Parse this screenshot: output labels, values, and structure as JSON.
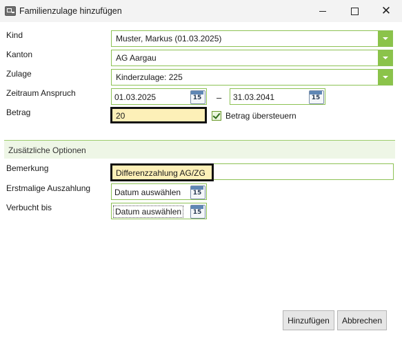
{
  "window": {
    "title": "Familienzulage hinzufügen"
  },
  "form": {
    "kind": {
      "label": "Kind",
      "value": "Muster, Markus (01.03.2025)"
    },
    "kanton": {
      "label": "Kanton",
      "value": "AG Aargau"
    },
    "zulage": {
      "label": "Zulage",
      "value": "Kinderzulage:  225"
    },
    "zeitraum": {
      "label": "Zeitraum Anspruch",
      "from": "01.03.2025",
      "separator": "–",
      "to": "31.03.2041"
    },
    "betrag": {
      "label": "Betrag",
      "value": "20",
      "override_label": "Betrag übersteuern",
      "override_checked": true
    }
  },
  "optionen": {
    "header": "Zusätzliche Optionen",
    "bemerkung": {
      "label": "Bemerkung",
      "value": "Differenzzahlung AG/ZG"
    },
    "erstmalige": {
      "label": "Erstmalige Auszahlung",
      "placeholder": "Datum auswählen"
    },
    "verbucht": {
      "label": "Verbucht bis",
      "placeholder": "Datum auswählen"
    }
  },
  "calendar_icon_text": "15",
  "buttons": {
    "add": "Hinzufügen",
    "cancel": "Abbrechen"
  },
  "colors": {
    "accent": "#8bc34a",
    "highlight": "#fdf0b8"
  }
}
